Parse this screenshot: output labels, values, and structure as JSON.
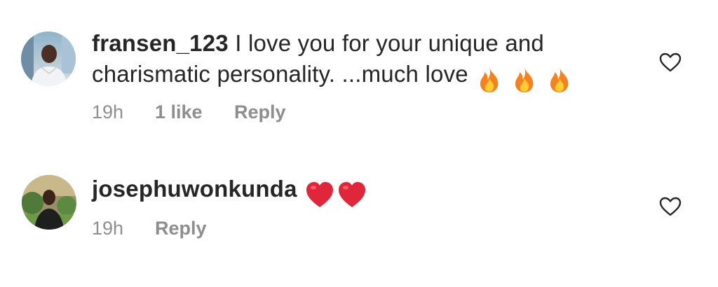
{
  "comments": [
    {
      "username": "fransen_123",
      "text_line1": "I love you for your unique and",
      "text_line2": "charismatic  personality. ...much love",
      "emojis": [
        "fire-emoji",
        "fire-emoji",
        "fire-emoji"
      ],
      "timestamp": "19h",
      "likes": "1 like",
      "reply_label": "Reply",
      "like_icon": "heart-outline-icon"
    },
    {
      "username": "josephuwonkunda",
      "emojis": [
        "red-heart-emoji",
        "red-heart-emoji"
      ],
      "timestamp": "19h",
      "reply_label": "Reply",
      "like_icon": "heart-outline-icon"
    }
  ],
  "colors": {
    "primary_text": "#262626",
    "secondary_text": "#8e8e8e",
    "heart_red": "#e0263a",
    "fire_orange": "#f5821f"
  }
}
